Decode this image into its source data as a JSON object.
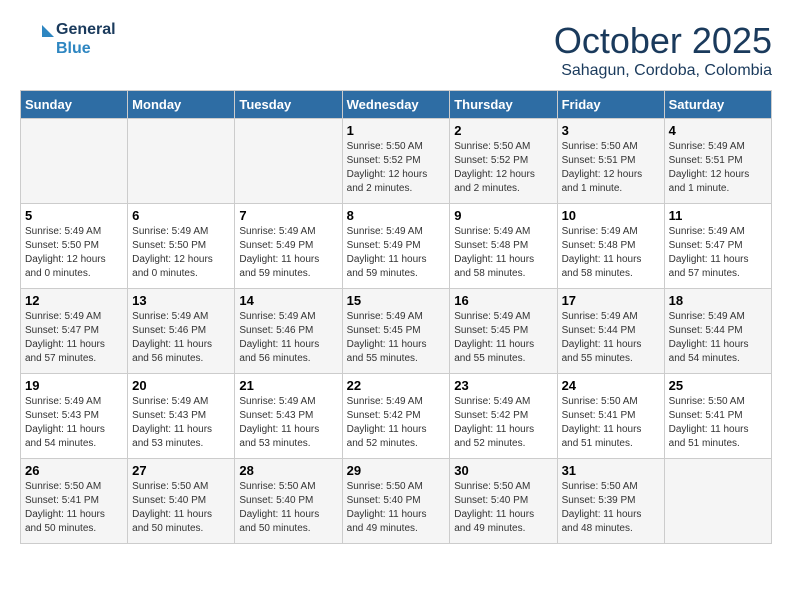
{
  "header": {
    "logo_line1": "General",
    "logo_line2": "Blue",
    "month": "October 2025",
    "location": "Sahagun, Cordoba, Colombia"
  },
  "weekdays": [
    "Sunday",
    "Monday",
    "Tuesday",
    "Wednesday",
    "Thursday",
    "Friday",
    "Saturday"
  ],
  "weeks": [
    [
      {
        "day": "",
        "info": ""
      },
      {
        "day": "",
        "info": ""
      },
      {
        "day": "",
        "info": ""
      },
      {
        "day": "1",
        "info": "Sunrise: 5:50 AM\nSunset: 5:52 PM\nDaylight: 12 hours\nand 2 minutes."
      },
      {
        "day": "2",
        "info": "Sunrise: 5:50 AM\nSunset: 5:52 PM\nDaylight: 12 hours\nand 2 minutes."
      },
      {
        "day": "3",
        "info": "Sunrise: 5:50 AM\nSunset: 5:51 PM\nDaylight: 12 hours\nand 1 minute."
      },
      {
        "day": "4",
        "info": "Sunrise: 5:49 AM\nSunset: 5:51 PM\nDaylight: 12 hours\nand 1 minute."
      }
    ],
    [
      {
        "day": "5",
        "info": "Sunrise: 5:49 AM\nSunset: 5:50 PM\nDaylight: 12 hours\nand 0 minutes."
      },
      {
        "day": "6",
        "info": "Sunrise: 5:49 AM\nSunset: 5:50 PM\nDaylight: 12 hours\nand 0 minutes."
      },
      {
        "day": "7",
        "info": "Sunrise: 5:49 AM\nSunset: 5:49 PM\nDaylight: 11 hours\nand 59 minutes."
      },
      {
        "day": "8",
        "info": "Sunrise: 5:49 AM\nSunset: 5:49 PM\nDaylight: 11 hours\nand 59 minutes."
      },
      {
        "day": "9",
        "info": "Sunrise: 5:49 AM\nSunset: 5:48 PM\nDaylight: 11 hours\nand 58 minutes."
      },
      {
        "day": "10",
        "info": "Sunrise: 5:49 AM\nSunset: 5:48 PM\nDaylight: 11 hours\nand 58 minutes."
      },
      {
        "day": "11",
        "info": "Sunrise: 5:49 AM\nSunset: 5:47 PM\nDaylight: 11 hours\nand 57 minutes."
      }
    ],
    [
      {
        "day": "12",
        "info": "Sunrise: 5:49 AM\nSunset: 5:47 PM\nDaylight: 11 hours\nand 57 minutes."
      },
      {
        "day": "13",
        "info": "Sunrise: 5:49 AM\nSunset: 5:46 PM\nDaylight: 11 hours\nand 56 minutes."
      },
      {
        "day": "14",
        "info": "Sunrise: 5:49 AM\nSunset: 5:46 PM\nDaylight: 11 hours\nand 56 minutes."
      },
      {
        "day": "15",
        "info": "Sunrise: 5:49 AM\nSunset: 5:45 PM\nDaylight: 11 hours\nand 55 minutes."
      },
      {
        "day": "16",
        "info": "Sunrise: 5:49 AM\nSunset: 5:45 PM\nDaylight: 11 hours\nand 55 minutes."
      },
      {
        "day": "17",
        "info": "Sunrise: 5:49 AM\nSunset: 5:44 PM\nDaylight: 11 hours\nand 55 minutes."
      },
      {
        "day": "18",
        "info": "Sunrise: 5:49 AM\nSunset: 5:44 PM\nDaylight: 11 hours\nand 54 minutes."
      }
    ],
    [
      {
        "day": "19",
        "info": "Sunrise: 5:49 AM\nSunset: 5:43 PM\nDaylight: 11 hours\nand 54 minutes."
      },
      {
        "day": "20",
        "info": "Sunrise: 5:49 AM\nSunset: 5:43 PM\nDaylight: 11 hours\nand 53 minutes."
      },
      {
        "day": "21",
        "info": "Sunrise: 5:49 AM\nSunset: 5:43 PM\nDaylight: 11 hours\nand 53 minutes."
      },
      {
        "day": "22",
        "info": "Sunrise: 5:49 AM\nSunset: 5:42 PM\nDaylight: 11 hours\nand 52 minutes."
      },
      {
        "day": "23",
        "info": "Sunrise: 5:49 AM\nSunset: 5:42 PM\nDaylight: 11 hours\nand 52 minutes."
      },
      {
        "day": "24",
        "info": "Sunrise: 5:50 AM\nSunset: 5:41 PM\nDaylight: 11 hours\nand 51 minutes."
      },
      {
        "day": "25",
        "info": "Sunrise: 5:50 AM\nSunset: 5:41 PM\nDaylight: 11 hours\nand 51 minutes."
      }
    ],
    [
      {
        "day": "26",
        "info": "Sunrise: 5:50 AM\nSunset: 5:41 PM\nDaylight: 11 hours\nand 50 minutes."
      },
      {
        "day": "27",
        "info": "Sunrise: 5:50 AM\nSunset: 5:40 PM\nDaylight: 11 hours\nand 50 minutes."
      },
      {
        "day": "28",
        "info": "Sunrise: 5:50 AM\nSunset: 5:40 PM\nDaylight: 11 hours\nand 50 minutes."
      },
      {
        "day": "29",
        "info": "Sunrise: 5:50 AM\nSunset: 5:40 PM\nDaylight: 11 hours\nand 49 minutes."
      },
      {
        "day": "30",
        "info": "Sunrise: 5:50 AM\nSunset: 5:40 PM\nDaylight: 11 hours\nand 49 minutes."
      },
      {
        "day": "31",
        "info": "Sunrise: 5:50 AM\nSunset: 5:39 PM\nDaylight: 11 hours\nand 48 minutes."
      },
      {
        "day": "",
        "info": ""
      }
    ]
  ]
}
